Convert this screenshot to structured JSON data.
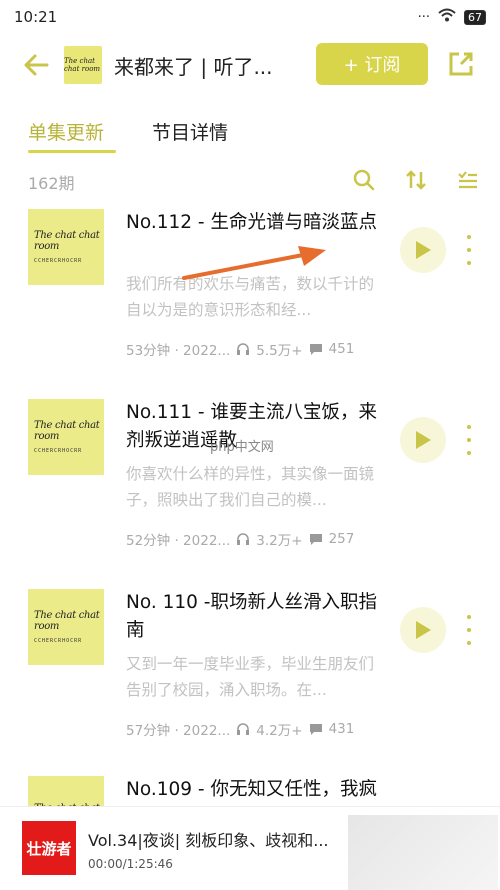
{
  "status": {
    "time": "10:21",
    "signal": "...",
    "wifi": "wifi",
    "battery": "67"
  },
  "header": {
    "back_icon": "back-arrow-icon",
    "title": "来都来了 | 听了...",
    "subscribe_label": "+ 订阅",
    "share_icon": "share-icon",
    "cover_text": "The chat chat room"
  },
  "tabs": [
    {
      "label": "单集更新",
      "active": true
    },
    {
      "label": "节目详情",
      "active": false
    }
  ],
  "list": {
    "count": "162期",
    "tools": [
      "search-icon",
      "sort-icon",
      "filter-list-icon"
    ]
  },
  "episodes": [
    {
      "title": "No.112 - 生命光谱与暗淡蓝点",
      "desc": "我们所有的欢乐与痛苦，数以千计的自以为是的意识形态和经...",
      "duration": "53分钟 · 2022...",
      "plays": "5.5万+",
      "comments": "451"
    },
    {
      "title": "No.111 - 谁要主流八宝饭，来剂叛逆逍遥散",
      "desc": "你喜欢什么样的异性，其实像一面镜子，照映出了我们自己的模...",
      "duration": "52分钟 · 2022...",
      "plays": "3.2万+",
      "comments": "257"
    },
    {
      "title": "No. 110 -职场新人丝滑入职指南",
      "desc": "又到一年一度毕业季，毕业生朋友们告别了校园，涌入职场。在...",
      "duration": "57分钟 · 2022...",
      "plays": "4.2万+",
      "comments": "431"
    },
    {
      "title": "No.109 - 你无知又任性，我疯",
      "desc": "",
      "duration": "",
      "plays": "",
      "comments": ""
    }
  ],
  "cover": {
    "line1": "The chat chat room",
    "line2": "CCHERCRHOCRR"
  },
  "watermark": "php中文网",
  "player": {
    "logo_text": "壮游者",
    "title": "Vol.34|夜谈| 刻板印象、歧视和...",
    "time": "00:00/1:25:46"
  },
  "colors": {
    "accent": "#d9d54b",
    "accent_text": "#b8b43a",
    "cover_bg": "#eceb8a",
    "arrow": "#e66d2e"
  }
}
